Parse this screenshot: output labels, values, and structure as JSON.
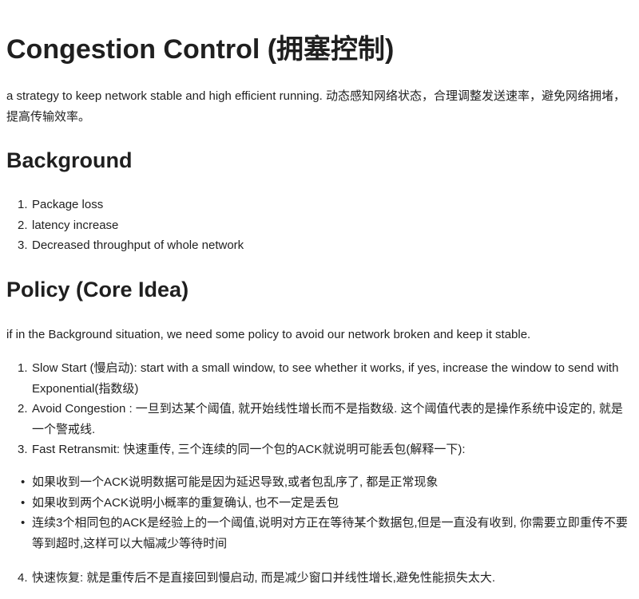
{
  "title": "Congestion Control (拥塞控制)",
  "intro": "a strategy to keep network stable and high efficient running. 动态感知网络状态，合理调整发送速率，避免网络拥堵，提高传输效率。",
  "background": {
    "heading": "Background",
    "items": [
      {
        "num": "1.",
        "text": "Package loss"
      },
      {
        "num": "2.",
        "text": "latency increase"
      },
      {
        "num": "3.",
        "text": "Decreased throughput of whole network"
      }
    ]
  },
  "policy": {
    "heading": "Policy (Core Idea)",
    "intro": "if in the Background situation, we need some policy to avoid our network broken and keep it stable.",
    "items": [
      {
        "num": "1.",
        "text": "Slow Start (慢启动): start with a small window, to see whether it works, if yes, increase the window to send with Exponential(指数级)"
      },
      {
        "num": "2.",
        "text": "Avoid Congestion : 一旦到达某个阈值, 就开始线性增长而不是指数级. 这个阈值代表的是操作系统中设定的, 就是一个警戒线."
      },
      {
        "num": "3.",
        "text": "Fast Retransmit: 快速重传, 三个连续的同一个包的ACK就说明可能丢包(解释一下):"
      }
    ],
    "bullets": [
      "如果收到一个ACK说明数据可能是因为延迟导致,或者包乱序了, 都是正常现象",
      "如果收到两个ACK说明小概率的重复确认, 也不一定是丢包",
      "连续3个相同包的ACK是经验上的一个阈值,说明对方正在等待某个数据包,但是一直没有收到, 你需要立即重传不要等到超时,这样可以大幅减少等待时间"
    ],
    "recovery": {
      "num": "4.",
      "text": "快速恢复: 就是重传后不是直接回到慢启动, 而是减少窗口并线性增长,避免性能损失太大."
    }
  }
}
